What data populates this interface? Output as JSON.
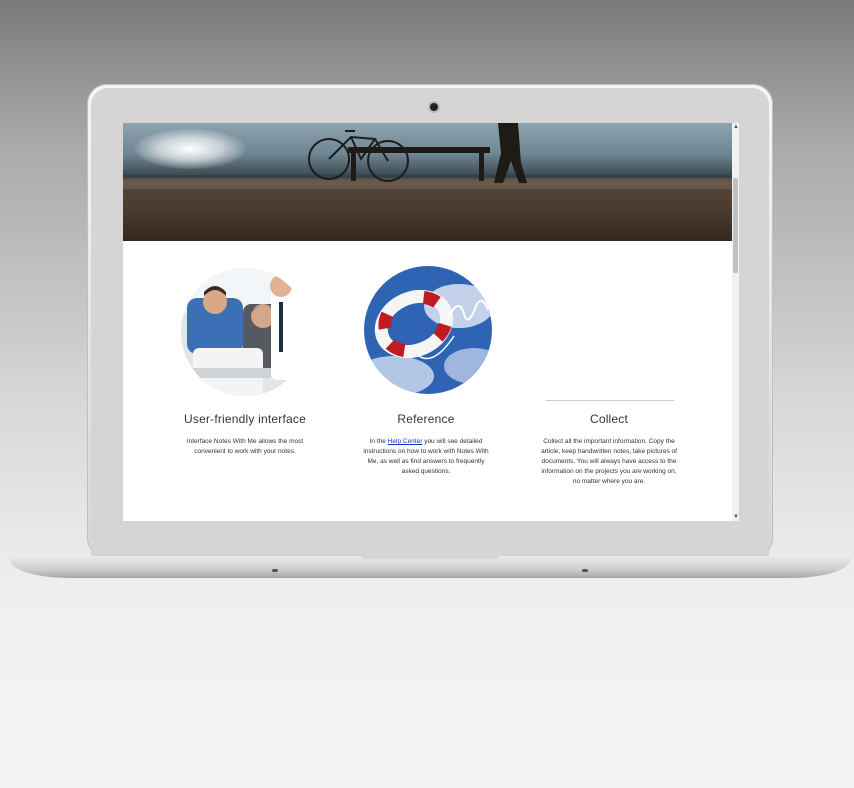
{
  "page": {
    "features": [
      {
        "title": "User-friendly interface",
        "text": "Interface Notes With Me allows the most convenient to work with your notes.",
        "image": "business-people-photo"
      },
      {
        "title": "Reference",
        "text_before": "In the ",
        "link": "Help Center",
        "text_after": " you will see detailed instructions on how to work with Notes With Me, as well as find answers to frequently asked questions.",
        "image": "lifebuoy-photo"
      },
      {
        "title": "Collect",
        "text": "Collect all the important information. Copy the article, keep handwritten notes, take pictures of documents. You will always have access to the information on the projects you are working on, no matter where you are."
      }
    ],
    "colors": {
      "link": "#1a33cc",
      "text": "#333333",
      "background": "#ffffff"
    }
  }
}
